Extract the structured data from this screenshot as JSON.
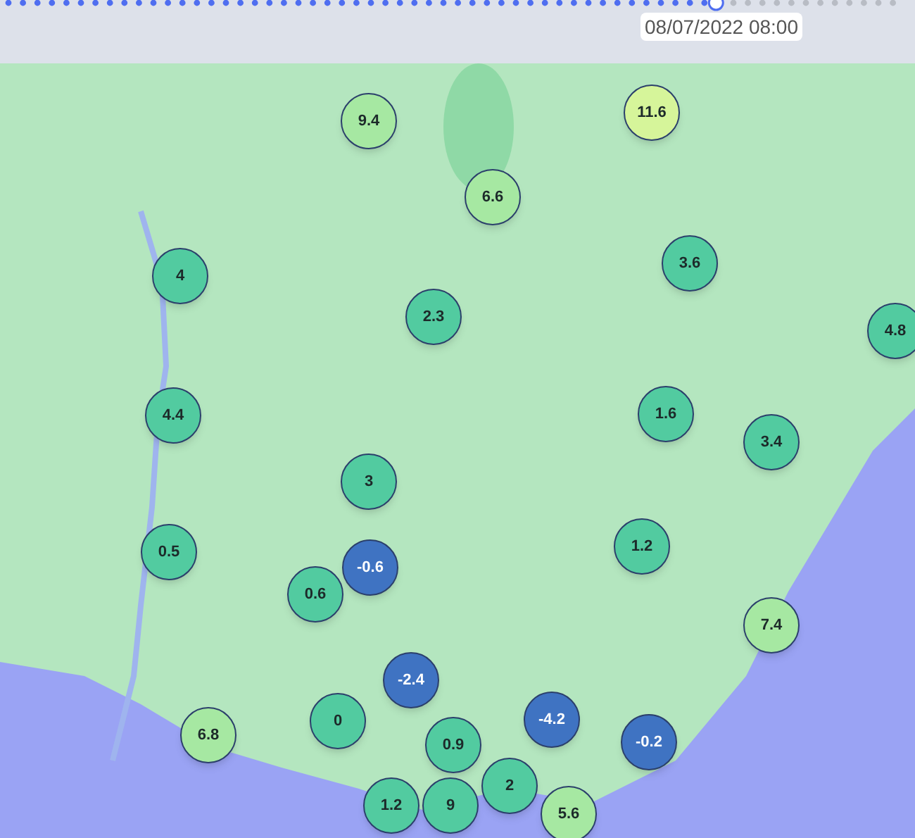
{
  "timeline": {
    "level": 0.8,
    "timestamp": "08/07/2022 08:00"
  },
  "markers": [
    {
      "value": "9.4",
      "color": "#a6e8a2"
    },
    {
      "value": "11.6",
      "color": "#d6f59a"
    },
    {
      "value": "6.6",
      "color": "#a6e8a2"
    },
    {
      "value": "3.6",
      "color": "#52cba0"
    },
    {
      "value": "4",
      "color": "#52cba0"
    },
    {
      "value": "2.3",
      "color": "#52cba0"
    },
    {
      "value": "4.8",
      "color": "#52cba0"
    },
    {
      "value": "4.4",
      "color": "#52cba0"
    },
    {
      "value": "1.6",
      "color": "#52cba0"
    },
    {
      "value": "3.4",
      "color": "#52cba0"
    },
    {
      "value": "3",
      "color": "#52cba0"
    },
    {
      "value": "0.5",
      "color": "#52cba0"
    },
    {
      "value": "-0.6",
      "color": "#3f73c2"
    },
    {
      "value": "1.2",
      "color": "#52cba0"
    },
    {
      "value": "0.6",
      "color": "#52cba0"
    },
    {
      "value": "7.4",
      "color": "#a6e8a2"
    },
    {
      "value": "-2.4",
      "color": "#3f73c2"
    },
    {
      "value": "0",
      "color": "#52cba0"
    },
    {
      "value": "-4.2",
      "color": "#3f73c2"
    },
    {
      "value": "-0.2",
      "color": "#3f73c2"
    },
    {
      "value": "6.8",
      "color": "#a6e8a2"
    },
    {
      "value": "0.9",
      "color": "#52cba0"
    },
    {
      "value": "2",
      "color": "#52cba0"
    },
    {
      "value": "9",
      "color": "#52cba0"
    },
    {
      "value": "1.2",
      "color": "#52cba0"
    },
    {
      "value": "5.6",
      "color": "#a6e8a2"
    }
  ]
}
